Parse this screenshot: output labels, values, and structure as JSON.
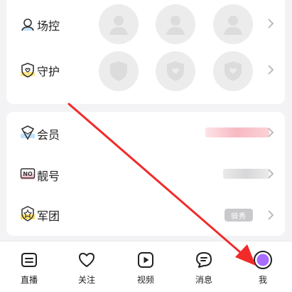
{
  "sections": {
    "changkong": {
      "label": "场控"
    },
    "shouhu": {
      "label": "守护"
    },
    "huiyuan": {
      "label": "会员"
    },
    "lianghao": {
      "label": "靓号"
    },
    "juntuan": {
      "label": "军团",
      "badge": "骑秀"
    }
  },
  "tabbar": {
    "items": [
      {
        "label": "直播",
        "icon": "live-icon"
      },
      {
        "label": "关注",
        "icon": "heart-icon"
      },
      {
        "label": "视频",
        "icon": "play-icon"
      },
      {
        "label": "消息",
        "icon": "message-icon"
      },
      {
        "label": "我",
        "icon": "profile-avatar-icon"
      }
    ]
  },
  "colors": {
    "accent_purple": "#a86cff",
    "accent_yellow": "#fbe16a",
    "accent_blue": "#bfe3ff",
    "arrow_red": "#f22a2a"
  }
}
